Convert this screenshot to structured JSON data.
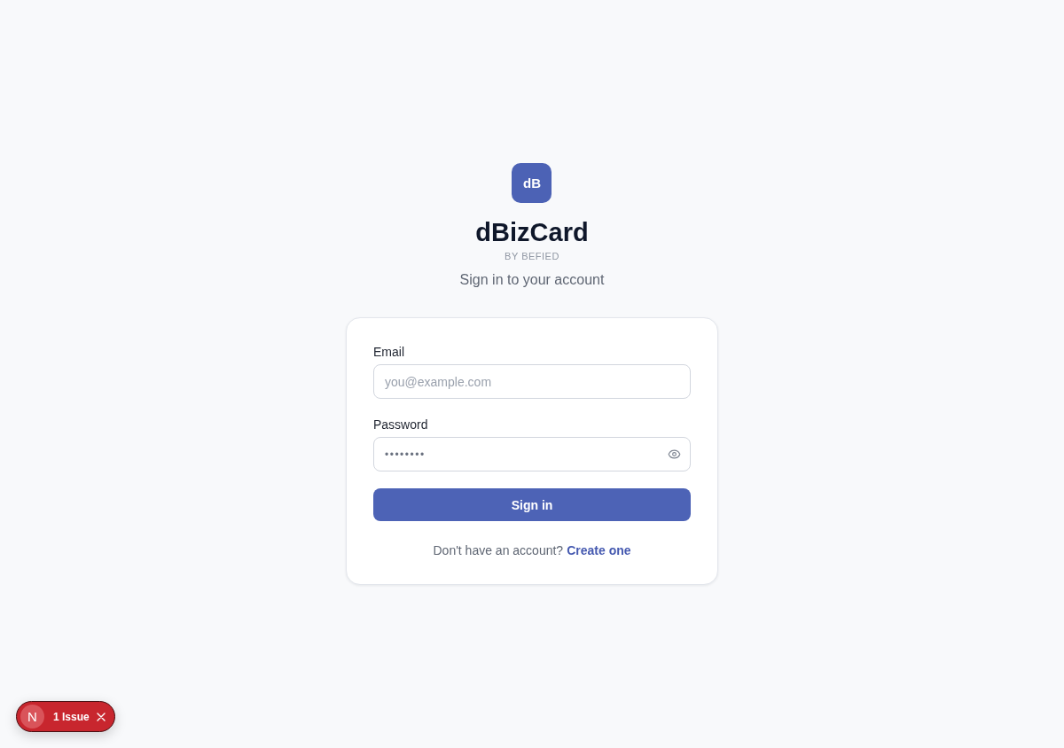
{
  "logo": {
    "mark": "dB",
    "title": "dBizCard",
    "tagline": "BY BEFIED"
  },
  "subtitle": "Sign in to your account",
  "form": {
    "fields": [
      {
        "kind": "text",
        "label": "Email",
        "placeholder": "you@example.com"
      },
      {
        "kind": "password",
        "label": "Password",
        "value": "••••••••"
      }
    ],
    "submit": "Sign in",
    "footer": {
      "text": "Don't have an account?",
      "link": "Create one"
    }
  },
  "issue_badge": {
    "mark": "N",
    "label": "1 Issue"
  }
}
